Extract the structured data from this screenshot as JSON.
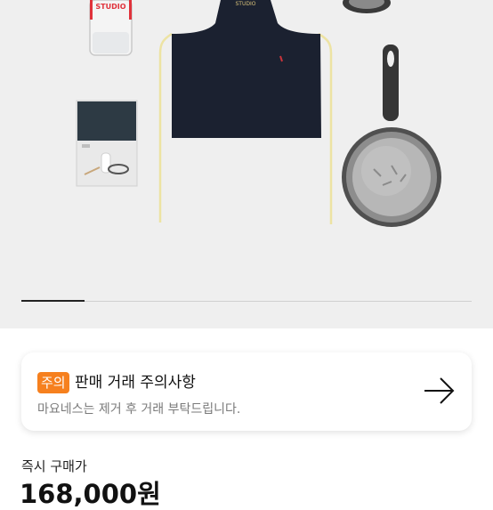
{
  "gallery": {
    "product_alt": "",
    "glass_print": "STUDIO",
    "apron_print": "STUDIO",
    "progress": 0.14,
    "accent_color": "#f6801e"
  },
  "notice": {
    "badge": "주의",
    "title": "판매 거래 주의사항",
    "description": "마요네스는 제거 후 거래 부탁드립니다."
  },
  "purchase": {
    "label": "즉시 구매가",
    "price": "168,000원"
  }
}
